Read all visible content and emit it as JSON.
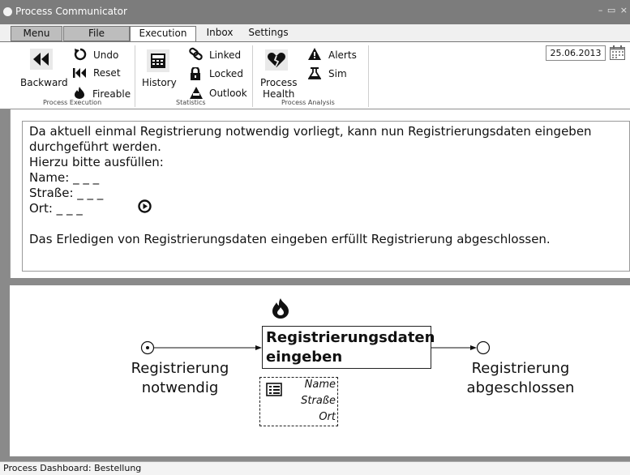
{
  "window": {
    "title": "Process Communicator",
    "controls": "– ▭ ×"
  },
  "menu": {
    "tabs": [
      "Menu",
      "File",
      "Execution",
      "Inbox",
      "Settings"
    ],
    "active": "Execution"
  },
  "ribbon": {
    "process_execution": {
      "label": "Process Execution",
      "backward": "Backward",
      "undo": "Undo",
      "reset": "Reset",
      "fireable": "Fireable"
    },
    "statistics": {
      "label": "Statistics",
      "history": "History",
      "linked": "Linked",
      "locked": "Locked",
      "outlook": "Outlook"
    },
    "process_analysis": {
      "label": "Process Analysis",
      "health_line1": "Process",
      "health_line2": "Health",
      "alerts": "Alerts",
      "sim": "Sim"
    },
    "date": "25.06.2013"
  },
  "task_text": {
    "line1": "Da aktuell einmal Registrierung notwendig vorliegt, kann nun Registrierungsdaten eingeben",
    "line2": "durchgeführt werden.",
    "line3": "Hierzu bitte ausfüllen:",
    "line4": "Name: _ _ _",
    "line5": "Straße: _ _ _",
    "line6": "Ort: _ _ _",
    "line7": "Das Erledigen von Registrierungsdaten eingeben erfüllt Registrierung abgeschlossen."
  },
  "diagram": {
    "start_line1": "Registrierung",
    "start_line2": "notwendig",
    "task_line1": "Registrierungsdaten",
    "task_line2": "eingeben",
    "fields": [
      "Name",
      "Straße",
      "Ort"
    ],
    "end_line1": "Registrierung",
    "end_line2": "abgeschlossen"
  },
  "status": "Process Dashboard: Bestellung"
}
